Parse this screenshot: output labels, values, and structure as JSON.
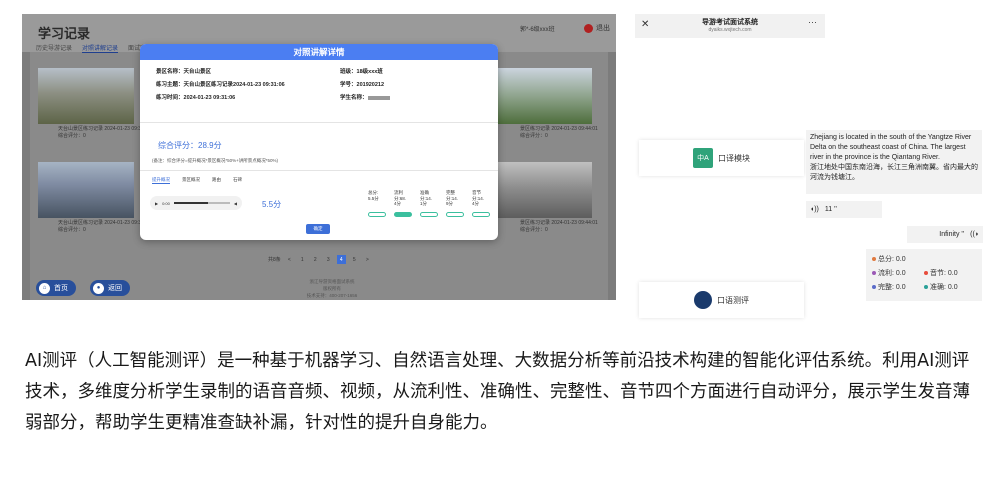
{
  "screen": {
    "title": "学习记录",
    "tabs": [
      "历史导游记录",
      "对照讲解记录",
      "面试实训记录"
    ],
    "user": "郭*-6级xxx班",
    "logout": "退出",
    "thumbs": [
      {
        "caption": "天台山景区练习记录 2024-01-23 09:31:06",
        "sub": "综合评分：0"
      },
      {
        "caption": "天台山景区练习记录 2024-01-23 09:31:06",
        "sub": "综合评分：0"
      },
      {
        "caption": "景区练习记录 2024-01-23 09:44:01",
        "sub": "综合评分：0"
      },
      {
        "caption": "景区练习记录 2024-01-23 09:44:01",
        "sub": "综合评分：0"
      }
    ],
    "pager": [
      "共8条",
      "<",
      "1",
      "2",
      "3",
      "4",
      "5",
      ">"
    ],
    "pager_current": "4",
    "footer": [
      "浙江导游资格面试系统",
      "版权所有",
      "技术支持：400-207-1656"
    ],
    "nav_home": "首页",
    "nav_back": "返回"
  },
  "modal": {
    "title": "对照讲解详情",
    "scenic_label": "景区名称：",
    "scenic_value": "天台山景区",
    "topic_label": "练习主题：",
    "topic_value": "天台山景区练习记录2024-01-23 09:31:06",
    "time_label": "练习时间：",
    "time_value": "2024-01-23 09:31:06",
    "class_label": "班级：",
    "class_value": "18级xxx班",
    "id_label": "学号：",
    "id_value": "201920212",
    "name_label": "学生名称：",
    "name_value": "",
    "score": "综合评分：28.9分",
    "note": "(备注：综合评分=提升概况*景区概况*50%+讲所景点概况*50%)",
    "tabs": [
      "提升概况",
      "景区概况",
      "路由",
      "石碑"
    ],
    "player_time": "0:00",
    "big_score": "5.5分",
    "subscores": [
      {
        "label": "总分:",
        "value": "5.5分",
        "on": false
      },
      {
        "label": "流利分:68.",
        "value": "4分",
        "on": true
      },
      {
        "label": "准确分:14.",
        "value": "1分",
        "on": false
      },
      {
        "label": "完整分:14.",
        "value": "9分",
        "on": false
      },
      {
        "label": "音节分:14.",
        "value": "4分",
        "on": false
      }
    ],
    "ok": "确定"
  },
  "phone": {
    "title": "导游考试面试系统",
    "url": "dyaiks.wxjtech.com",
    "module1": "口译模块",
    "module2": "口语测评",
    "bubble_en": "Zhejiang is located in the south of the Yangtze River Delta on the southeast coast of China. The largest river in the province is the Qiantang River.",
    "bubble_cn": "浙江地处中国东南沿海，长江三角洲南翼。省内最大的河流为钱塘江。",
    "voice1": "11 ''",
    "voice2": "Infinity ''",
    "scores": {
      "total": "总分: 0.0",
      "fluency": "流利: 0.0",
      "syllable": "音节: 0.0",
      "complete": "完整: 0.0",
      "accuracy": "准确: 0.0"
    },
    "colors": {
      "accent": "#3d6fd8",
      "dot_total": "#e07a3f",
      "dot_fluency": "#9b59b6",
      "dot_syllable": "#e74c3c",
      "dot_complete": "#5b6cc9",
      "dot_accuracy": "#2aa198"
    }
  },
  "paragraph": "AI测评（人工智能测评）是一种基于机器学习、自然语言处理、大数据分析等前沿技术构建的智能化评估系统。利用AI测评技术，多维度分析学生录制的语音音频、视频，从流利性、准确性、完整性、音节四个方面进行自动评分，展示学生发音薄弱部分，帮助学生更精准查缺补漏，针对性的提升自身能力。"
}
